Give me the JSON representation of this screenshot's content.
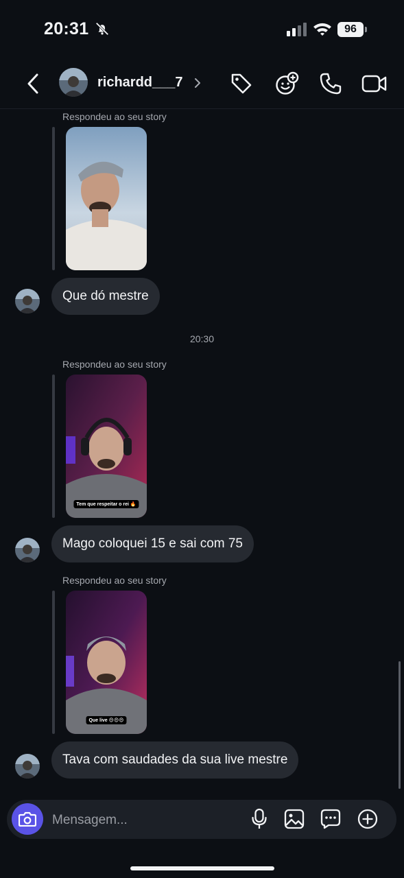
{
  "status_bar": {
    "time": "20:31",
    "battery": "96"
  },
  "header": {
    "username": "richardd___7"
  },
  "messages": [
    {
      "reply_label": "Respondeu ao seu story",
      "text": "Que dó mestre"
    },
    {
      "reply_label": "Respondeu ao seu story",
      "story_caption": "Tem que respeitar o rei 🔥",
      "text": "Mago coloquei 15 e sai com 75"
    },
    {
      "reply_label": "Respondeu ao seu story",
      "story_caption": "Que live 😍😍😍",
      "text": "Tava com saudades da sua live mestre"
    }
  ],
  "timestamp": "20:30",
  "composer": {
    "placeholder": "Mensagem..."
  },
  "icons": [
    "bell-muted-icon",
    "signal-icon",
    "wifi-icon",
    "battery-icon",
    "back-icon",
    "chevron-right-icon",
    "tag-icon",
    "sticker-icon",
    "phone-icon",
    "video-icon",
    "camera-icon",
    "microphone-icon",
    "gallery-icon",
    "chat-sticker-icon",
    "plus-icon"
  ],
  "colors": {
    "background": "#0c0f14",
    "bubble": "#262a31",
    "accent": "#5a53e6"
  }
}
